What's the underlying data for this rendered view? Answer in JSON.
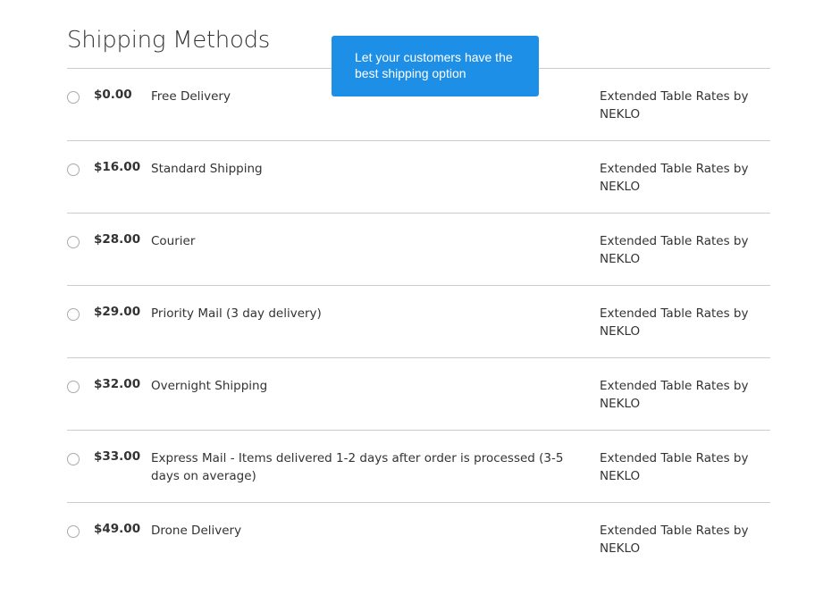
{
  "page": {
    "title": "Shipping Methods"
  },
  "tooltip": {
    "text": "Let your customers have the best shipping option",
    "color": "#1e8fe6"
  },
  "methods": [
    {
      "price": "$0.00",
      "method": "Free Delivery",
      "carrier": "Extended Table Rates by NEKLO",
      "selected": false
    },
    {
      "price": "$16.00",
      "method": "Standard Shipping",
      "carrier": "Extended Table Rates by NEKLO",
      "selected": false
    },
    {
      "price": "$28.00",
      "method": "Courier",
      "carrier": "Extended Table Rates by NEKLO",
      "selected": false
    },
    {
      "price": "$29.00",
      "method": "Priority Mail (3 day delivery)",
      "carrier": "Extended Table Rates by NEKLO",
      "selected": false
    },
    {
      "price": "$32.00",
      "method": "Overnight Shipping",
      "carrier": "Extended Table Rates by NEKLO",
      "selected": false
    },
    {
      "price": "$33.00",
      "method": "Express Mail - Items delivered 1-2 days after order is processed (3-5 days on average)",
      "carrier": "Extended Table Rates by NEKLO",
      "selected": false
    },
    {
      "price": "$49.00",
      "method": "Drone Delivery",
      "carrier": "Extended Table Rates by NEKLO",
      "selected": false
    }
  ]
}
